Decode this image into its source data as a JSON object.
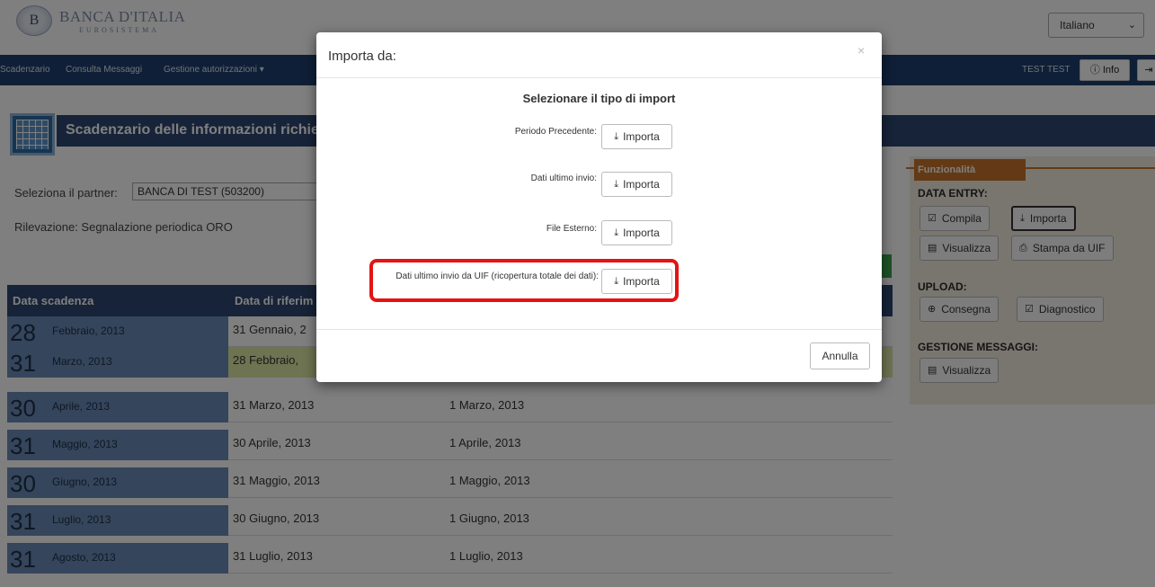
{
  "header": {
    "logo_title": "BANCA D'ITALIA",
    "logo_subtitle": "EUROSISTEMA",
    "logo_emblem": "B",
    "language": "Italiano"
  },
  "nav": {
    "items": [
      "Scadenzario",
      "Consulta Messaggi",
      "Gestione autorizzazioni ▾"
    ],
    "user": "TEST TEST",
    "info_label": "Info"
  },
  "page": {
    "title": "Scadenzario delle informazioni richie",
    "partner_label": "Seleziona il partner:",
    "partner_value": "BANCA DI TEST (503200)",
    "rilevazione": "Rilevazione: Segnalazione periodica ORO"
  },
  "table": {
    "headers": [
      "Data scadenza",
      "Data di riferim"
    ],
    "rows": [
      {
        "day": "28",
        "month": "Febbraio, 2013",
        "ref": "31 Gennaio, 2",
        "start": ""
      },
      {
        "day": "31",
        "month": "Marzo, 2013",
        "ref": "28 Febbraio,",
        "start": ""
      },
      {
        "day": "30",
        "month": "Aprile, 2013",
        "ref": "31 Marzo, 2013",
        "start": "1   Marzo, 2013"
      },
      {
        "day": "31",
        "month": "Maggio, 2013",
        "ref": "30 Aprile, 2013",
        "start": "1   Aprile, 2013"
      },
      {
        "day": "30",
        "month": "Giugno, 2013",
        "ref": "31 Maggio, 2013",
        "start": "1   Maggio, 2013"
      },
      {
        "day": "31",
        "month": "Luglio, 2013",
        "ref": "30 Giugno, 2013",
        "start": "1   Giugno, 2013"
      },
      {
        "day": "31",
        "month": "Agosto, 2013",
        "ref": "31 Luglio, 2013",
        "start": "1   Luglio, 2013"
      }
    ]
  },
  "panel": {
    "tab": "Funzionalità",
    "data_entry": "DATA ENTRY:",
    "compila": "Compila",
    "importa": "Importa",
    "visualizza": "Visualizza",
    "stampa": "Stampa da UIF",
    "upload": "UPLOAD:",
    "consegna": "Consegna",
    "diagnostico": "Diagnostico",
    "gestione": "GESTIONE MESSAGGI:",
    "visualizza2": "Visualizza"
  },
  "modal": {
    "title": "Importa da:",
    "close": "×",
    "subtitle": "Selezionare il tipo di import",
    "options": [
      {
        "label": "Periodo Precedente:",
        "button": "Importa"
      },
      {
        "label": "Dati ultimo invio:",
        "button": "Importa"
      },
      {
        "label": "File Esterno:",
        "button": "Importa"
      },
      {
        "label": "Dati ultimo invio da UIF (ricopertura totale dei dati):",
        "button": "Importa"
      }
    ],
    "cancel": "Annulla"
  },
  "colors": {
    "navbar": "#1f3f6e",
    "title_bar": "#2c4770",
    "highlight_row": "#dce8a2",
    "panel_tab": "#c6742a",
    "annotation_red": "#e31414"
  }
}
